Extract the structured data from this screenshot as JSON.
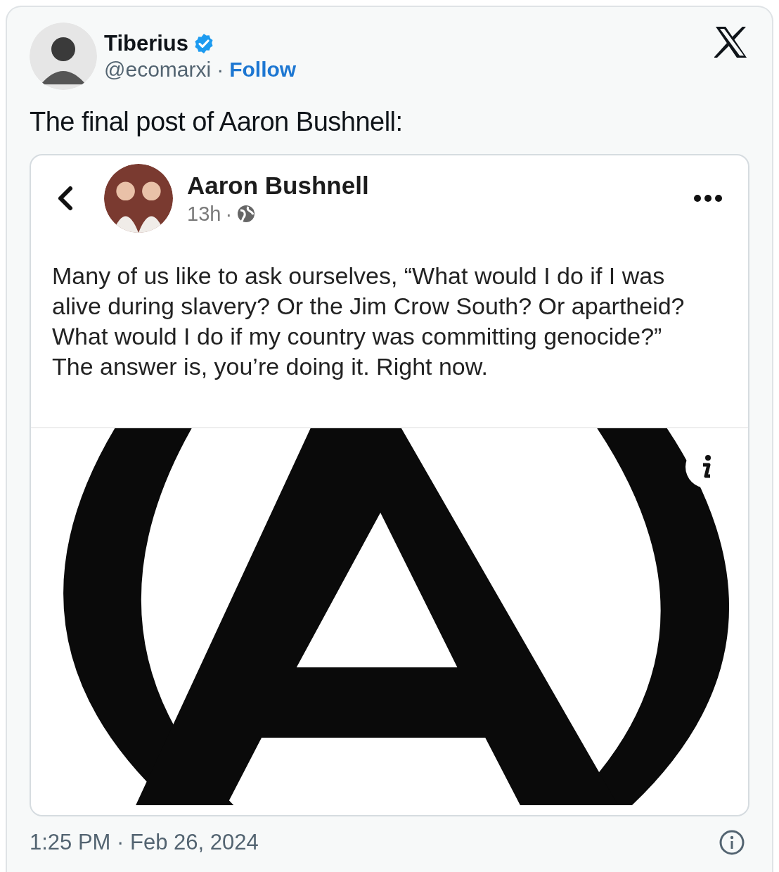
{
  "tweet": {
    "author": {
      "name": "Tiberius",
      "verified": true,
      "handle": "@ecomarxi",
      "separator": "·",
      "follow": "Follow"
    },
    "text": "The final post of Aaron Bushnell:",
    "embedded_post": {
      "author": "Aaron Bushnell",
      "time": "13h",
      "separator": "·",
      "text": "Many of us like to ask ourselves, “What would I do if I was\nalive during slavery? Or the Jim Crow South? Or apartheid?\nWhat would I do if my country was committing genocide?”\nThe answer is, you’re doing it. Right now."
    },
    "timestamp": "1:25 PM · Feb 26, 2024"
  }
}
